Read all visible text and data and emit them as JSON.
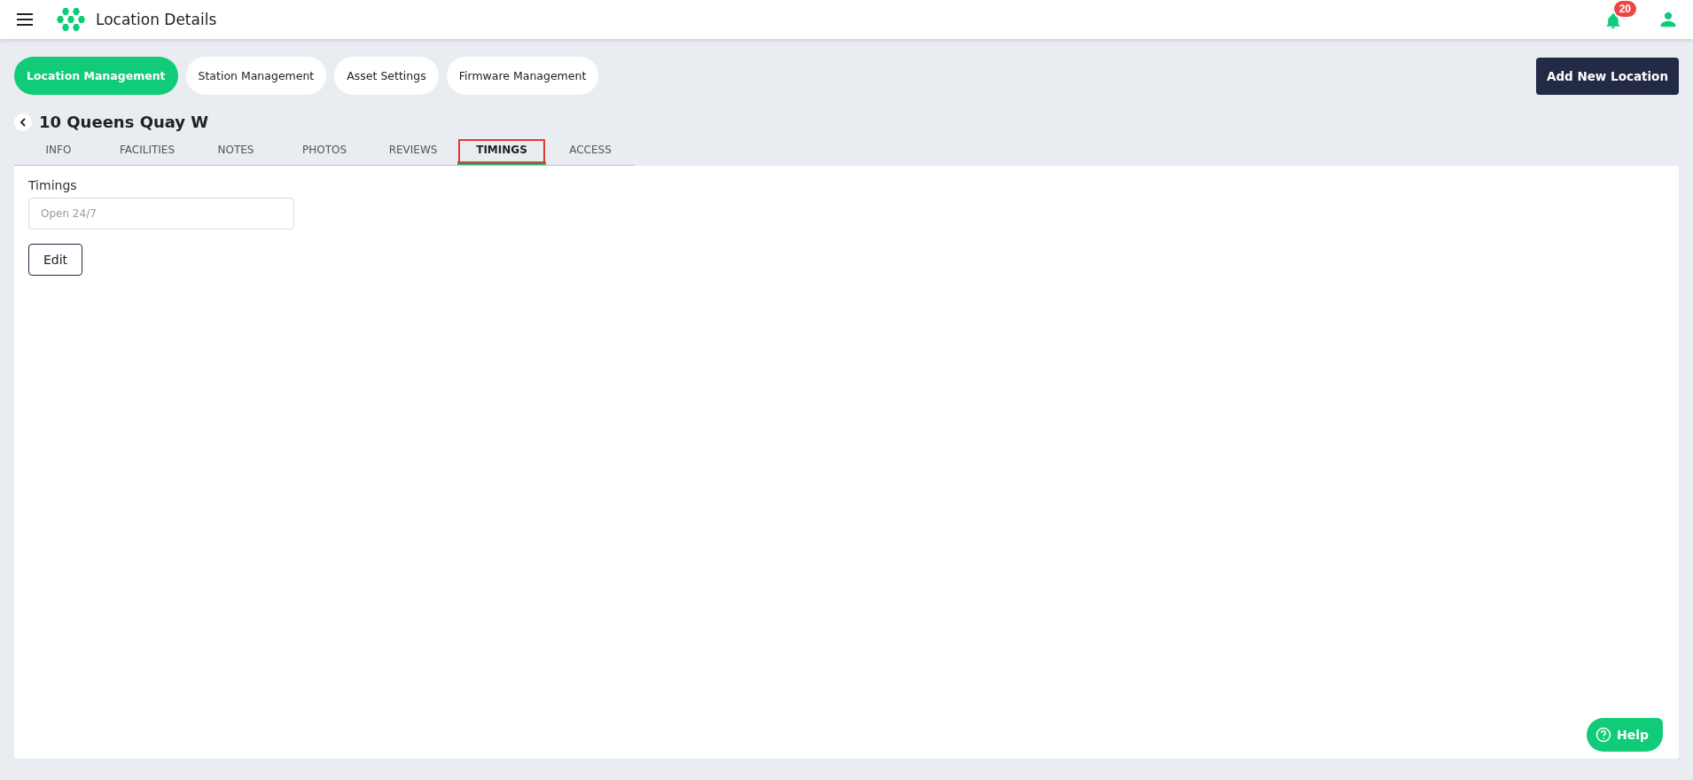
{
  "header": {
    "title": "Location Details",
    "notification_count": "20"
  },
  "nav": [
    {
      "label": "Location Management",
      "selected": true
    },
    {
      "label": "Station Management",
      "selected": false
    },
    {
      "label": "Asset Settings",
      "selected": false
    },
    {
      "label": "Firmware Management",
      "selected": false
    }
  ],
  "add_button": "Add New Location",
  "location_title": "10 Queens Quay W",
  "tabs": [
    {
      "label": "INFO",
      "selected": false
    },
    {
      "label": "FACILITIES",
      "selected": false
    },
    {
      "label": "NOTES",
      "selected": false
    },
    {
      "label": "PHOTOS",
      "selected": false
    },
    {
      "label": "REVIEWS",
      "selected": false
    },
    {
      "label": "TIMINGS",
      "selected": true
    },
    {
      "label": "ACCESS",
      "selected": false
    }
  ],
  "timings": {
    "label": "Timings",
    "placeholder": "Open 24/7",
    "edit_button": "Edit"
  },
  "help_button": "Help"
}
